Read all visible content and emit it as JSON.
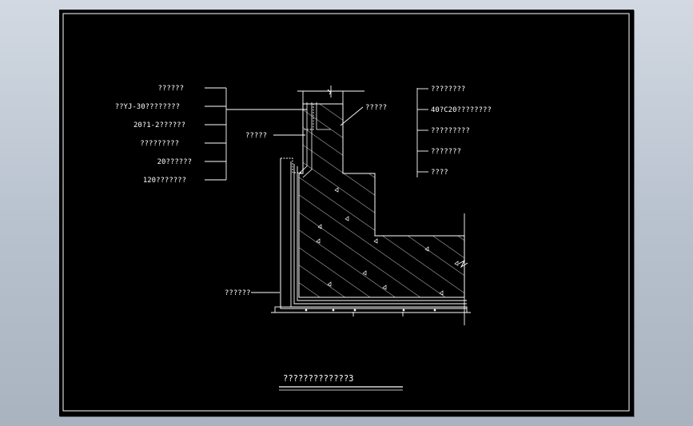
{
  "left_labels": [
    "??????",
    "??YJ-30????????",
    "20?1-2??????",
    "?????????",
    "20??????",
    "120???????"
  ],
  "right_labels": [
    "????????",
    "40?C20????????",
    "?????????",
    "???????",
    "????"
  ],
  "top_label": "?????",
  "mid_label": "?????",
  "bottom_label": "??????",
  "drawing_title": "?????????????3",
  "colors": {
    "background": "#000000",
    "lines": "#ffffff",
    "frame": "#ffffff",
    "window": "#bcc5d0"
  }
}
